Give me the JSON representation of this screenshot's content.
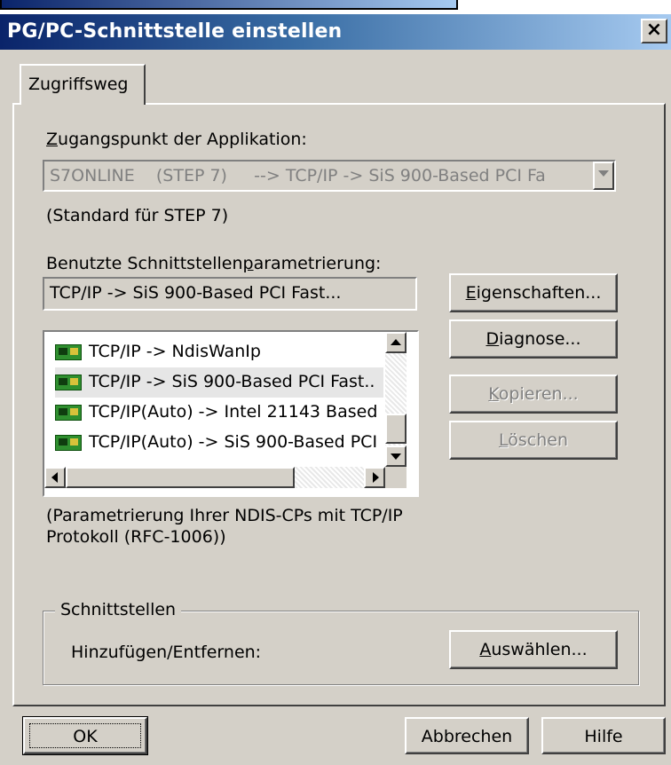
{
  "window": {
    "title": "PG/PC-Schnittstelle einstellen",
    "close_glyph": "×"
  },
  "tabs": [
    {
      "label": "Zugriffsweg",
      "active": true
    }
  ],
  "access_point": {
    "label_accel": "Z",
    "label_rest": "ugangspunkt der Applikation:",
    "value": "S7ONLINE    (STEP 7)     --> TCP/IP -> SiS 900-Based PCI Fa",
    "note": "(Standard für STEP 7)"
  },
  "interface_param": {
    "label_pre": "Benutzte Schnittstellen",
    "label_accel": "p",
    "label_post": "arametrierung:",
    "current_value": "TCP/IP -> SiS 900-Based PCI Fast...",
    "items": [
      {
        "label": "TCP/IP -> NdisWanIp",
        "icon": "network-card-icon"
      },
      {
        "label": "TCP/IP -> SiS 900-Based PCI Fast..",
        "icon": "network-card-icon",
        "selected": true
      },
      {
        "label": "TCP/IP(Auto) -> Intel 21143 Based",
        "icon": "network-card-icon"
      },
      {
        "label": "TCP/IP(Auto) -> SiS 900-Based PCI",
        "icon": "network-card-icon"
      }
    ],
    "description": "(Parametrierung Ihrer NDIS-CPs mit TCP/IP",
    "description_line2": "Protokoll (RFC-1006))"
  },
  "side_buttons": {
    "properties": {
      "accel": "E",
      "rest": "igenschaften...",
      "enabled": true
    },
    "diagnose": {
      "accel": "D",
      "rest": "iagnose...",
      "enabled": true
    },
    "copy": {
      "accel": "K",
      "rest": "opieren...",
      "enabled": false
    },
    "delete": {
      "accel": "L",
      "rest": "öschen",
      "enabled": false
    }
  },
  "interfaces_group": {
    "legend": "Schnittstellen",
    "add_remove_label": "Hinzufügen/Entfernen:",
    "select_button": {
      "accel": "A",
      "rest": "uswählen..."
    }
  },
  "footer": {
    "ok": "OK",
    "cancel": "Abbrechen",
    "help": "Hilfe"
  },
  "colors": {
    "title_start": "#0a246a",
    "title_end": "#a6caf0",
    "face": "#d4d0c8",
    "disabled_text": "#808080"
  }
}
